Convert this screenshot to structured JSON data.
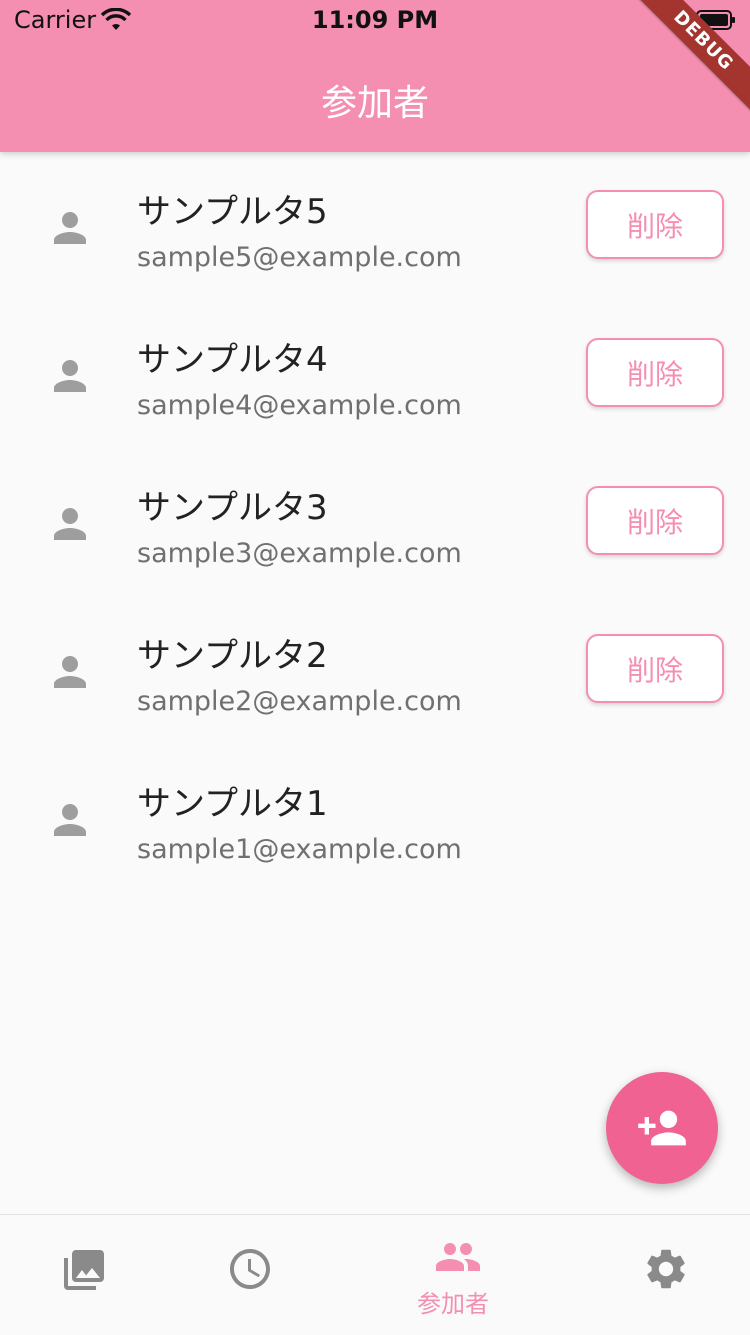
{
  "status": {
    "carrier": "Carrier",
    "time": "11:09 PM"
  },
  "app_bar": {
    "title": "参加者",
    "debug_banner": "DEBUG"
  },
  "participants": [
    {
      "name": "サンプルタ5",
      "email": "sample5@example.com",
      "delete_label": "削除"
    },
    {
      "name": "サンプルタ4",
      "email": "sample4@example.com",
      "delete_label": "削除"
    },
    {
      "name": "サンプルタ3",
      "email": "sample3@example.com",
      "delete_label": "削除"
    },
    {
      "name": "サンプルタ2",
      "email": "sample2@example.com",
      "delete_label": "削除"
    },
    {
      "name": "サンプルタ1",
      "email": "sample1@example.com"
    }
  ],
  "fab": {
    "icon": "person-add-icon"
  },
  "bottom_nav": {
    "items": [
      {
        "icon": "photo-library-icon",
        "label": ""
      },
      {
        "icon": "clock-icon",
        "label": ""
      },
      {
        "icon": "people-icon",
        "label": "参加者",
        "active": true
      },
      {
        "icon": "settings-icon",
        "label": ""
      }
    ]
  },
  "colors": {
    "primary": "#f48fb1",
    "accent": "#f06292",
    "inactive_icon": "#8a8a8a"
  }
}
